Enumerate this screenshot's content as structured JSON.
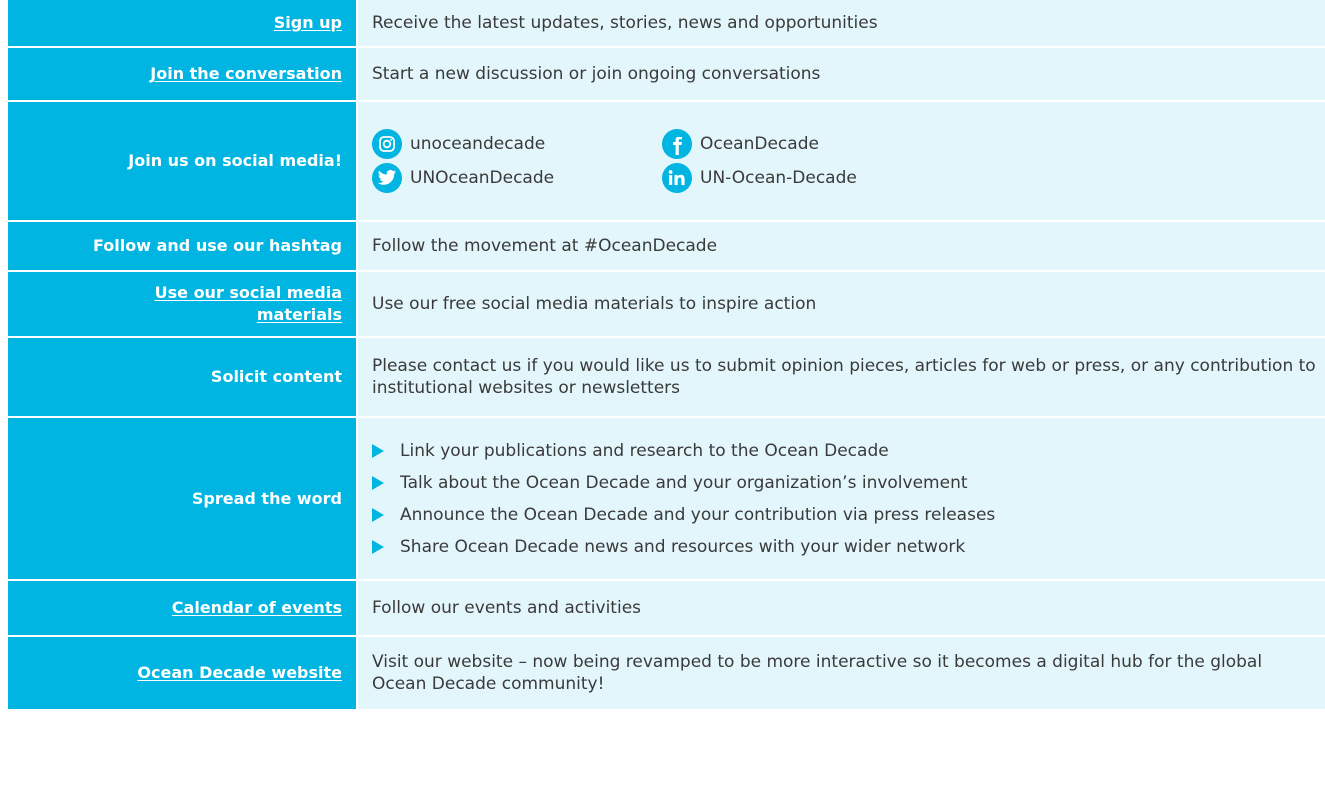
{
  "colors": {
    "accent": "#00b5e2",
    "content_bg": "#e3f6fc",
    "text": "#3a3a3a"
  },
  "rows": [
    {
      "label": "Sign up",
      "text": "Receive the latest updates, stories, news and opportunities"
    },
    {
      "label": "Join the conversation",
      "text": "Start a new discussion or join ongoing conversations"
    },
    {
      "label": "Join us on social media!",
      "social": [
        {
          "icon": "instagram-icon",
          "handle": "unoceandecade"
        },
        {
          "icon": "facebook-icon",
          "handle": "OceanDecade"
        },
        {
          "icon": "twitter-icon",
          "handle": "UNOceanDecade"
        },
        {
          "icon": "linkedin-icon",
          "handle": "UN-Ocean-Decade"
        }
      ]
    },
    {
      "label": "Follow and use our hashtag",
      "text": "Follow the movement at #OceanDecade"
    },
    {
      "label_line1": "Use our social media",
      "label_line2": "materials",
      "text": "Use our free social media materials to inspire action"
    },
    {
      "label": "Solicit content",
      "text": "Please contact us if you would like us to submit opinion pieces, articles for web or press, or any contribution to institutional websites or newsletters"
    },
    {
      "label": "Spread the word",
      "bullets": [
        "Link your publications and research to the Ocean Decade",
        "Talk about the Ocean Decade and your organization’s involvement",
        "Announce the Ocean Decade and your contribution via press releases",
        "Share Ocean Decade news and resources with your wider network"
      ]
    },
    {
      "label": "Calendar of events",
      "text": "Follow our events and activities"
    },
    {
      "label": "Ocean Decade website",
      "text": "Visit our website – now being revamped to be more interactive so it becomes a digital hub for the global Ocean Decade community!"
    }
  ]
}
